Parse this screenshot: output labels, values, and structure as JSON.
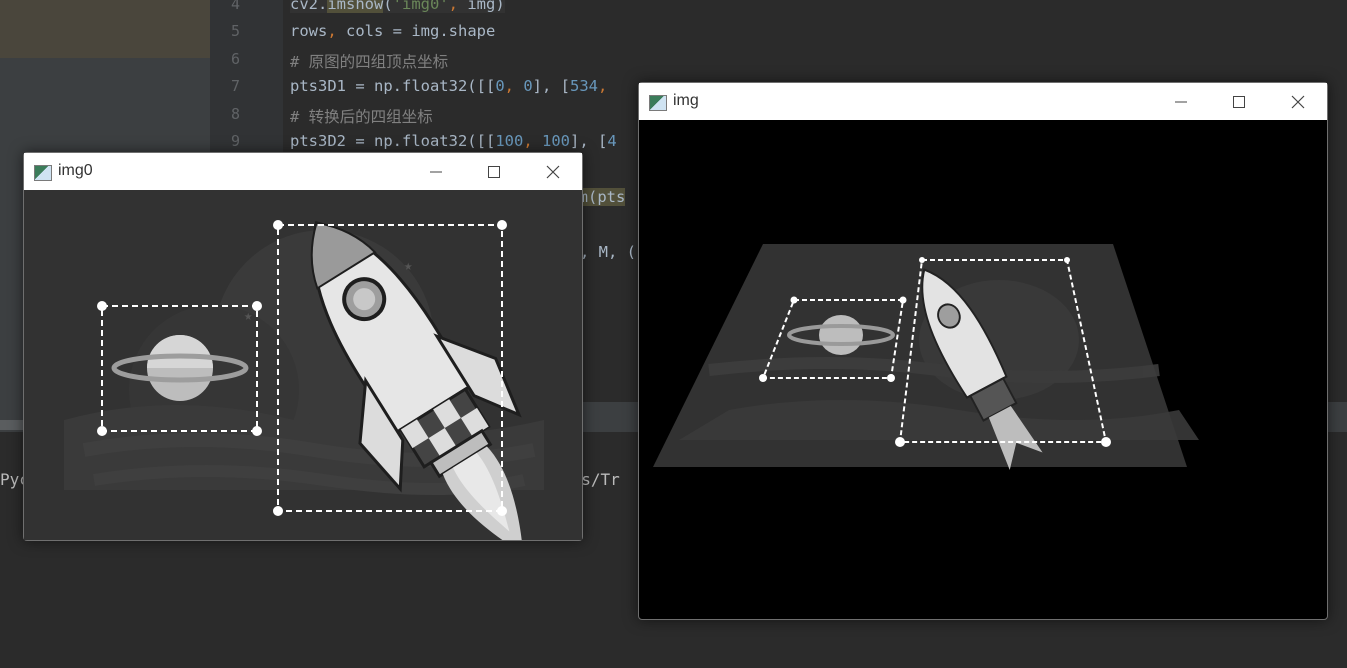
{
  "editor": {
    "line_numbers": [
      "4",
      "5",
      "6",
      "7",
      "8",
      "9"
    ],
    "lines": [
      [
        {
          "t": "cv2.",
          "c": ""
        },
        {
          "t": "imshow",
          "c": "hl"
        },
        {
          "t": "(",
          "c": ""
        },
        {
          "t": "'img0'",
          "c": "str"
        },
        {
          "t": ", ",
          "c": "pun"
        },
        {
          "t": "img)",
          "c": ""
        }
      ],
      [
        {
          "t": "rows",
          "c": ""
        },
        {
          "t": ", ",
          "c": "pun"
        },
        {
          "t": "cols = img.shape",
          "c": ""
        }
      ],
      [
        {
          "t": "# 原图的四组顶点坐标",
          "c": "cm"
        }
      ],
      [
        {
          "t": "pts3D1 = np.float32([[",
          "c": ""
        },
        {
          "t": "0",
          "c": "num"
        },
        {
          "t": ", ",
          "c": "pun"
        },
        {
          "t": "0",
          "c": "num"
        },
        {
          "t": "], [",
          "c": ""
        },
        {
          "t": "534",
          "c": "num"
        },
        {
          "t": ", ",
          "c": "pun"
        }
      ],
      [
        {
          "t": "# 转换后的四组坐标",
          "c": "cm"
        }
      ],
      [
        {
          "t": "pts3D2 = np.float32([[",
          "c": ""
        },
        {
          "t": "100",
          "c": "num"
        },
        {
          "t": ", ",
          "c": "pun"
        },
        {
          "t": "100",
          "c": "num"
        },
        {
          "t": "], [",
          "c": ""
        },
        {
          "t": "4",
          "c": "num"
        }
      ]
    ],
    "fragment_a": "rm(pts",
    "fragment_b": ", M, (",
    "tool_left": "Pyc",
    "tool_right": "ers/Tr"
  },
  "windows": {
    "img0": {
      "title": "img0"
    },
    "img": {
      "title": "img"
    }
  },
  "colors": {
    "titlebar": "#ffffff",
    "scene_bg": "#323232",
    "ide_bg": "#2b2b2b"
  }
}
